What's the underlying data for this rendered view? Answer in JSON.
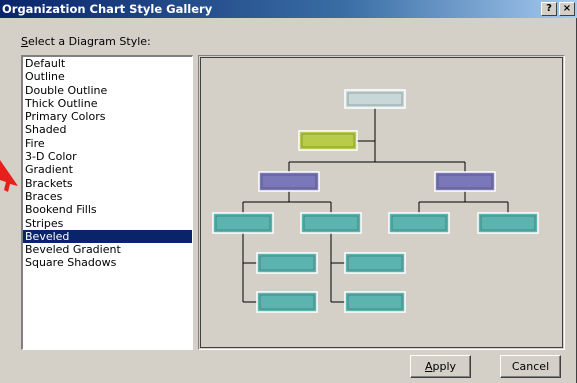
{
  "dialog": {
    "title": "Organization Chart Style Gallery",
    "help_glyph": "?",
    "close_glyph": "×",
    "list_label_mnemonic": "S",
    "list_label_rest": "elect a Diagram Style:",
    "styles": [
      "Default",
      "Outline",
      "Double Outline",
      "Thick Outline",
      "Primary Colors",
      "Shaded",
      "Fire",
      "3-D Color",
      "Gradient",
      "Brackets",
      "Braces",
      "Bookend Fills",
      "Stripes",
      "Beveled",
      "Beveled Gradient",
      "Square Shadows"
    ],
    "selected_style": "Beveled",
    "apply_mnemonic": "A",
    "apply_rest": "pply",
    "cancel_label": "Cancel"
  },
  "colors": {
    "dialog_bg": "#d4d0c8",
    "selection_bg": "#0a246a",
    "box_top": "#c8d8d8",
    "box_assistant": "#b8cc4a",
    "box_manager": "#7a78b8",
    "box_worker": "#5cb4b0",
    "connector": "#000000",
    "arrow": "#e8201c"
  },
  "preview_icons": {
    "annotation": "red-arrow-icon"
  }
}
